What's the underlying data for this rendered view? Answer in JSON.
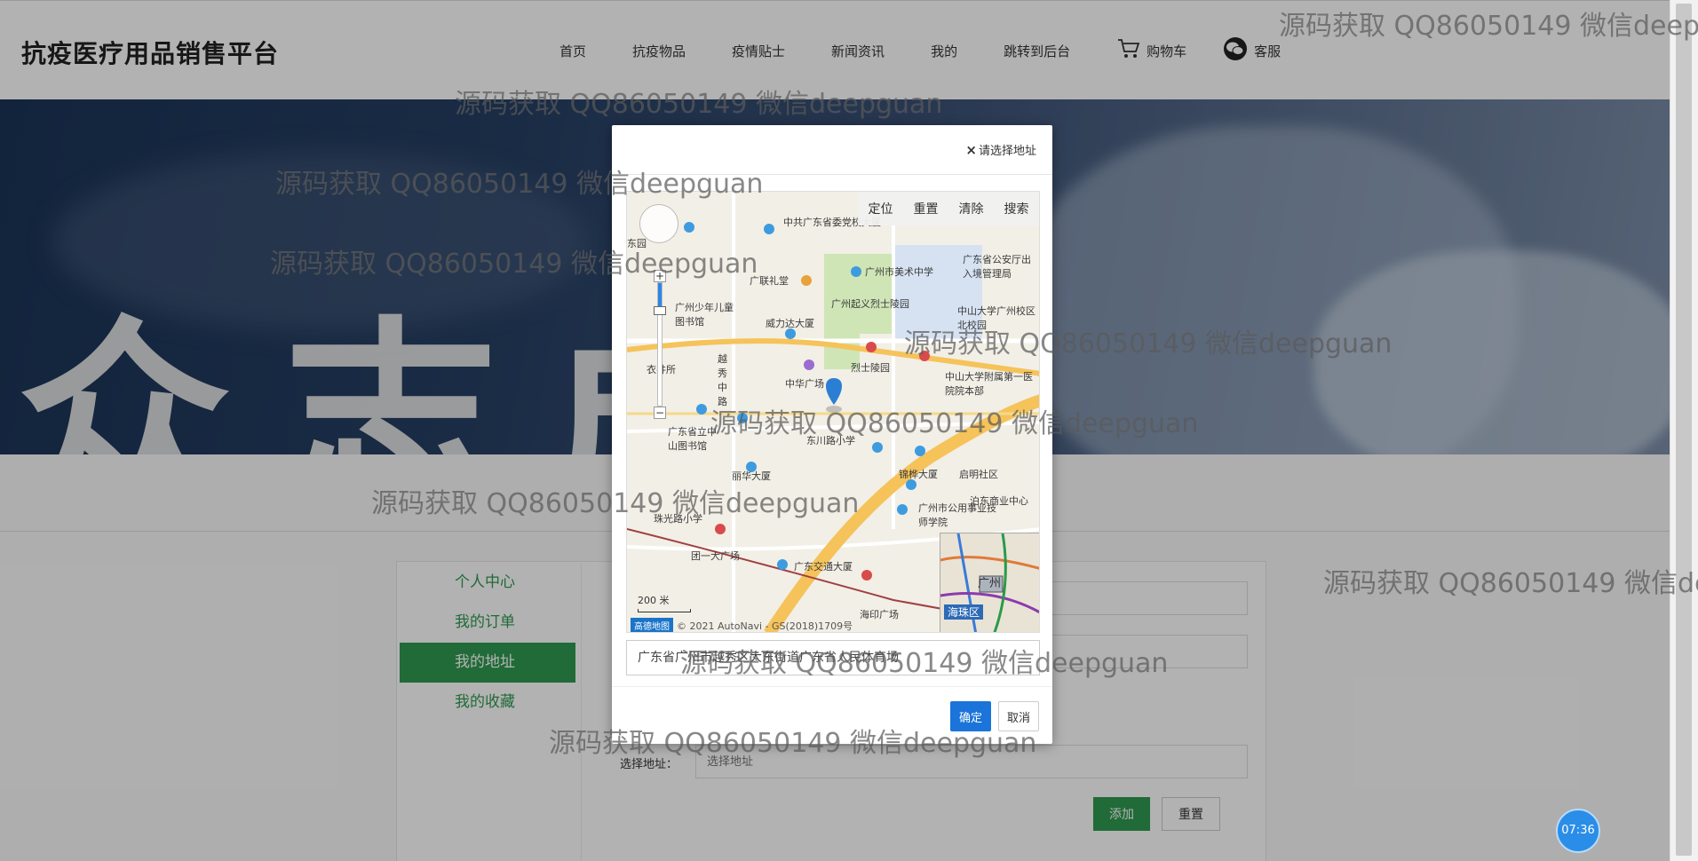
{
  "header": {
    "brand": "抗疫医疗用品销售平台",
    "nav": [
      {
        "label": "首页"
      },
      {
        "label": "抗疫物品"
      },
      {
        "label": "疫情贴士"
      },
      {
        "label": "新闻资讯"
      },
      {
        "label": "我的"
      },
      {
        "label": "跳转到后台"
      },
      {
        "label": "购物车",
        "icon": "cart-icon"
      },
      {
        "label": "客服",
        "icon": "wechat-icon"
      }
    ]
  },
  "banner": {
    "text": "众志成"
  },
  "side_menu": [
    {
      "label": "个人中心"
    },
    {
      "label": "我的订单"
    },
    {
      "label": "我的地址",
      "active": true
    },
    {
      "label": "我的收藏"
    }
  ],
  "form": {
    "address_label": "选择地址：",
    "address_placeholder": "选择地址",
    "add_button": "添加",
    "reset_button": "重置"
  },
  "dialog": {
    "title": "请选择地址",
    "close_glyph": "×",
    "toolbar": [
      "定位",
      "重置",
      "清除",
      "搜索"
    ],
    "scale_label": "200 米",
    "copyright": "© 2021 AutoNavi - GS(2018)1709号",
    "copyright_logo": "高德地图",
    "minimap_district": "海珠区",
    "minimap_city": "广州",
    "address_value": "广东省广州市越秀区大东街道广东省人民体育场",
    "ok_button": "确定",
    "cancel_button": "取消"
  },
  "map_labels": [
    "中共广东省委党校大厦",
    "广州市美术中学",
    "广东省公安厅出入境管理局",
    "广联礼堂",
    "广州少年儿童图书馆",
    "威力达大厦",
    "广州起义烈士陵园",
    "中山大学广州校区北校园",
    "烈士陵园",
    "中山大学附属第一医院院本部",
    "越秀中路",
    "中华广场",
    "衣井所",
    "广东省立中山图书馆",
    "东川路小学",
    "锦桦大厦",
    "启明社区",
    "丽华大厦",
    "珠光路小学",
    "广州市公用事业技师学院",
    "团一大广场",
    "广东交通大厦",
    "海印广场",
    "泊东商业中心",
    "东园"
  ],
  "watermarks": [
    "源码获取 QQ86050149 微信deepguan",
    "源码获取 QQ86050149 微信deepguan",
    "源码获取 QQ86050149 微信deepguan",
    "源码获取 QQ86050149 微信deepguan",
    "源码获取 QQ86050149 微信deepguan",
    "源码获取 QQ86050149 微信deepguan",
    "源码获取 QQ86050149 微信deepguan",
    "源码获取 QQ86050149 微信deepguan",
    "源码获取 QQ86050149 微信deepguan",
    "源码获取 QQ86050149 微信deepguan"
  ],
  "clock": "07:36",
  "colors": {
    "accent_green": "#2e9a4f",
    "primary_blue": "#1a74d9",
    "overlay": "rgba(0,0,0,0.30)"
  }
}
